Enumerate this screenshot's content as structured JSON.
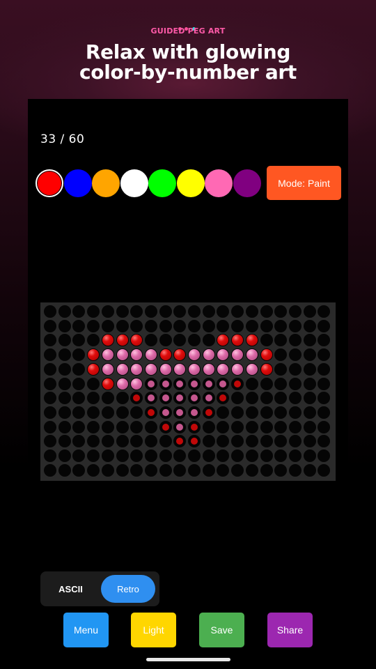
{
  "brand": "GUIDED PEG ART",
  "headline": [
    "Relax with glowing",
    "color-by-number art"
  ],
  "progress": {
    "text": "33 / 60",
    "filled": 33,
    "total": 60
  },
  "palette": {
    "colors": [
      "#ff0000",
      "#0000ff",
      "#ffa500",
      "#ffffff",
      "#00ff00",
      "#ffff00",
      "#ff69b4",
      "#800080"
    ],
    "selected_index": 0
  },
  "mode_button": {
    "label": "Mode: Paint",
    "color": "#ff5722"
  },
  "board": {
    "cols": 20,
    "rows": 12,
    "pattern": [
      "....................",
      "....................",
      "....RRR.....RRR.....",
      "...RPPPPRRPPPPPR....",
      "...RPPPPPPPPPPPR....",
      "....RPPppppppr......",
      "......rpppppr.......",
      ".......rpppr........",
      "........rpr.........",
      ".........rr.........",
      "....................",
      "...................."
    ],
    "legend": {
      "R": "filled red peg",
      "P": "filled pink peg",
      "r": "red target hole",
      "p": "pink target hole",
      ".": "empty hole"
    }
  },
  "view_toggle": {
    "options": [
      "ASCII",
      "Retro"
    ],
    "selected": "Retro"
  },
  "actions": [
    {
      "label": "Menu",
      "color": "#2196f3",
      "text_color": "#ffffff"
    },
    {
      "label": "Light",
      "color": "#ffd600",
      "text_color": "#ffffff"
    },
    {
      "label": "Save",
      "color": "#4caf50",
      "text_color": "#ffffff"
    },
    {
      "label": "Share",
      "color": "#9c27b0",
      "text_color": "#ffffff"
    }
  ]
}
